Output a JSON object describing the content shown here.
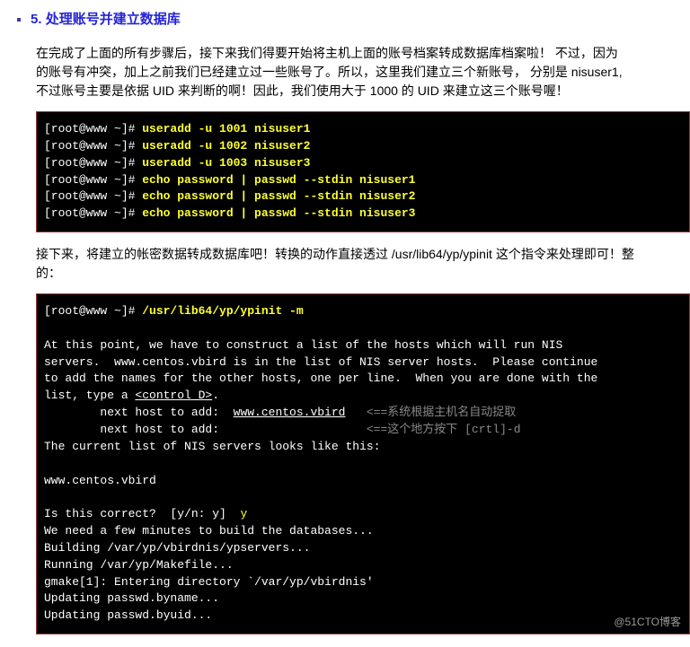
{
  "heading": {
    "number": "5.",
    "title": "处理账号并建立数据库"
  },
  "paragraph1_lines": [
    "在完成了上面的所有步骤后，接下来我们得要开始将主机上面的账号档案转成数据库档案啦！ 不过，因为",
    "的账号有冲突，加上之前我们已经建立过一些账号了。所以，这里我们建立三个新账号， 分别是 nisuser1,",
    "不过账号主要是依据 UID 来判断的啊！因此，我们使用大于 1000 的 UID 来建立这三个账号喔！"
  ],
  "terminal1": {
    "lines": [
      {
        "prompt": "[root@www ~]# ",
        "cmd": "useradd -u 1001 nisuser1"
      },
      {
        "prompt": "[root@www ~]# ",
        "cmd": "useradd -u 1002 nisuser2"
      },
      {
        "prompt": "[root@www ~]# ",
        "cmd": "useradd -u 1003 nisuser3"
      },
      {
        "prompt": "[root@www ~]# ",
        "cmd": "echo password | passwd --stdin nisuser1"
      },
      {
        "prompt": "[root@www ~]# ",
        "cmd": "echo password | passwd --stdin nisuser2"
      },
      {
        "prompt": "[root@www ~]# ",
        "cmd": "echo password | passwd --stdin nisuser3"
      }
    ]
  },
  "paragraph2_lines": [
    "接下来，将建立的帐密数据转成数据库吧！转换的动作直接透过 /usr/lib64/yp/ypinit 这个指令来处理即可！整",
    "的："
  ],
  "terminal2": {
    "prompt_line": {
      "prompt": "[root@www ~]# ",
      "cmd": "/usr/lib64/yp/ypinit -m"
    },
    "out1": "At this point, we have to construct a list of the hosts which will run NIS",
    "out2": "servers.  www.centos.vbird is in the list of NIS server hosts.  Please continue",
    "out3": "to add the names for the other hosts, one per line.  When you are done with the",
    "out4_a": "list, type a ",
    "out4_b": "<control D>",
    "out4_c": ".",
    "next1_label": "        next host to add:  ",
    "next1_host": "www.centos.vbird",
    "next1_comment": "   <==系统根据主机名自动捉取",
    "next2_label": "        next host to add:",
    "next2_comment": "                     <==这个地方按下 [crtl]-d",
    "out5": "The current list of NIS servers looks like this:",
    "out6": "www.centos.vbird",
    "correct_q": "Is this correct?  [y/n: y]  ",
    "correct_a": "y",
    "out7": "We need a few minutes to build the databases...",
    "out8": "Building /var/yp/vbirdnis/ypservers...",
    "out9": "Running /var/yp/Makefile...",
    "out10": "gmake[1]: Entering directory `/var/yp/vbirdnis'",
    "out11": "Updating passwd.byname...",
    "out12": "Updating passwd.byuid..."
  },
  "watermark": "@51CTO博客"
}
